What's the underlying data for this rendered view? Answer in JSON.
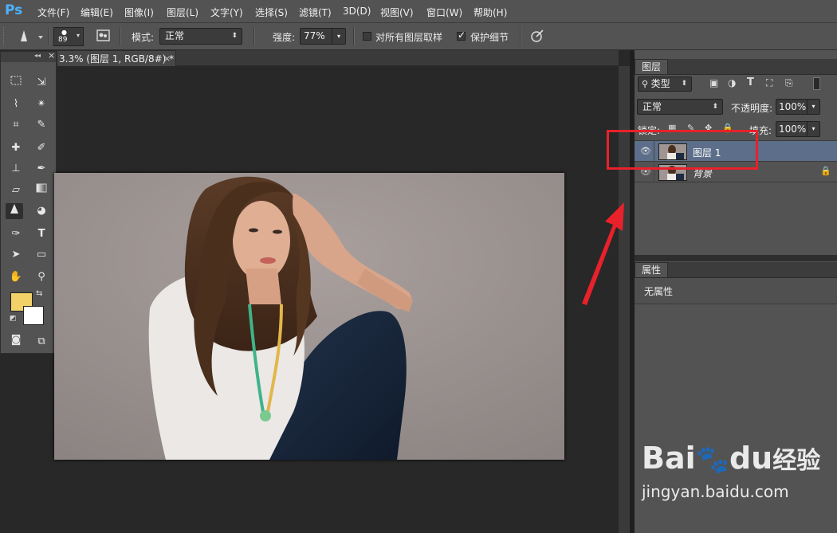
{
  "app": {
    "logo": "Ps"
  },
  "menu": [
    "文件(F)",
    "编辑(E)",
    "图像(I)",
    "图层(L)",
    "文字(Y)",
    "选择(S)",
    "滤镜(T)",
    "3D(D)",
    "视图(V)",
    "窗口(W)",
    "帮助(H)"
  ],
  "options": {
    "brush_size": "89",
    "mode_label": "模式:",
    "mode_value": "正常",
    "strength_label": "强度:",
    "strength_value": "77%",
    "sample_all_label": "对所有图层取样",
    "sample_all_checked": false,
    "protect_detail_label": "保护细节",
    "protect_detail_checked": true
  },
  "document": {
    "tab_title": "3.3% (图层 1, RGB/8#) *",
    "close": "×"
  },
  "tools_panel": {
    "collapse_glyph": "◂◂",
    "close": "×"
  },
  "colors": {
    "foreground": "#f2d168",
    "background": "#ffffff",
    "accent_annotation": "#e8212a"
  },
  "layers_panel": {
    "tab": "图层",
    "filter_kind": "类型",
    "blend_mode": "正常",
    "opacity_label": "不透明度:",
    "opacity_value": "100%",
    "lock_label": "锁定:",
    "fill_label": "填充:",
    "fill_value": "100%",
    "layers": [
      {
        "name": "图层 1",
        "selected": true,
        "visible": true,
        "locked": false
      },
      {
        "name": "背景",
        "selected": false,
        "visible": true,
        "locked": true
      }
    ]
  },
  "properties_panel": {
    "tab": "属性",
    "content": "无属性"
  },
  "watermark": {
    "brand": "Bai",
    "brand_cn": "经验",
    "brand_du": "du",
    "url": "jingyan.baidu.com"
  }
}
